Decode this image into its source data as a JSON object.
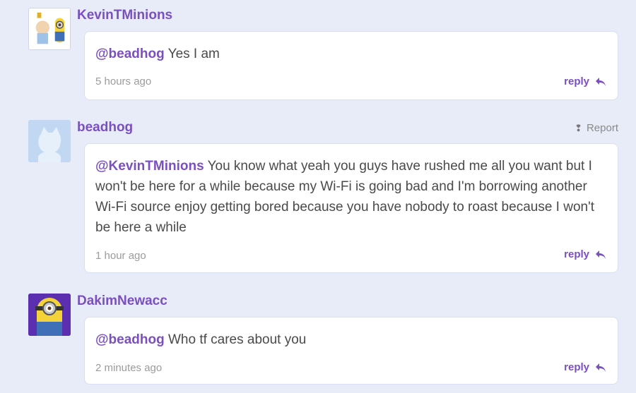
{
  "comments": [
    {
      "username": "KevinTMinions",
      "mention": "@beadhog",
      "text": " Yes I am",
      "timestamp": "5 hours ago",
      "reply_label": "reply"
    },
    {
      "username": "beadhog",
      "report_label": "Report",
      "mention": "@KevinTMinions",
      "text": " You know what yeah you guys have rushed me all you want but I won't be here for a while because my Wi-Fi is going bad and I'm borrowing another Wi-Fi source enjoy getting bored because you have nobody to roast because I won't be here a while",
      "timestamp": "1 hour ago",
      "reply_label": "reply"
    },
    {
      "username": "DakimNewacc",
      "mention": "@beadhog",
      "text": " Who tf cares about you",
      "timestamp": "2 minutes ago",
      "reply_label": "reply"
    }
  ],
  "colors": {
    "accent": "#7b4fc0",
    "background": "#e7ecf8",
    "card": "#ffffff",
    "muted": "#9b9b9b"
  },
  "icons": {
    "reply": "reply-arrow-icon",
    "report": "flag-icon"
  }
}
